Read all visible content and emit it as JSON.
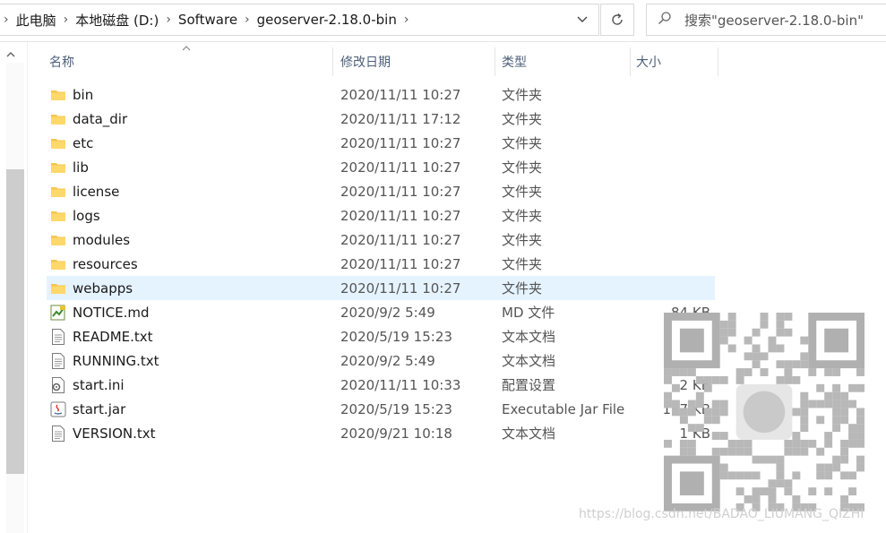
{
  "breadcrumb": {
    "items": [
      "此电脑",
      "本地磁盘 (D:)",
      "Software",
      "geoserver-2.18.0-bin"
    ]
  },
  "search": {
    "placeholder": "搜索\"geoserver-2.18.0-bin\""
  },
  "columns": {
    "name": "名称",
    "date": "修改日期",
    "type": "类型",
    "size": "大小"
  },
  "files": [
    {
      "name": "bin",
      "date": "2020/11/11 10:27",
      "type": "文件夹",
      "size": "",
      "icon": "folder-icon"
    },
    {
      "name": "data_dir",
      "date": "2020/11/11 17:12",
      "type": "文件夹",
      "size": "",
      "icon": "folder-icon"
    },
    {
      "name": "etc",
      "date": "2020/11/11 10:27",
      "type": "文件夹",
      "size": "",
      "icon": "folder-icon"
    },
    {
      "name": "lib",
      "date": "2020/11/11 10:27",
      "type": "文件夹",
      "size": "",
      "icon": "folder-icon"
    },
    {
      "name": "license",
      "date": "2020/11/11 10:27",
      "type": "文件夹",
      "size": "",
      "icon": "folder-icon"
    },
    {
      "name": "logs",
      "date": "2020/11/11 10:27",
      "type": "文件夹",
      "size": "",
      "icon": "folder-icon"
    },
    {
      "name": "modules",
      "date": "2020/11/11 10:27",
      "type": "文件夹",
      "size": "",
      "icon": "folder-icon"
    },
    {
      "name": "resources",
      "date": "2020/11/11 10:27",
      "type": "文件夹",
      "size": "",
      "icon": "folder-icon"
    },
    {
      "name": "webapps",
      "date": "2020/11/11 10:27",
      "type": "文件夹",
      "size": "",
      "icon": "folder-icon",
      "selected": true
    },
    {
      "name": "NOTICE.md",
      "date": "2020/9/2 5:49",
      "type": "MD 文件",
      "size": "84 KB",
      "icon": "markdown-file-icon"
    },
    {
      "name": "README.txt",
      "date": "2020/5/19 15:23",
      "type": "文本文档",
      "size": "1 KB",
      "icon": "text-file-icon"
    },
    {
      "name": "RUNNING.txt",
      "date": "2020/9/2 5:49",
      "type": "文本文档",
      "size": "4 KB",
      "icon": "text-file-icon"
    },
    {
      "name": "start.ini",
      "date": "2020/11/11 10:33",
      "type": "配置设置",
      "size": "2 KB",
      "icon": "config-file-icon"
    },
    {
      "name": "start.jar",
      "date": "2020/5/19 15:23",
      "type": "Executable Jar File",
      "size": "157 KB",
      "icon": "java-jar-icon"
    },
    {
      "name": "VERSION.txt",
      "date": "2020/9/21 10:18",
      "type": "文本文档",
      "size": "1 KB",
      "icon": "text-file-icon"
    }
  ],
  "watermark": "https://blog.csdn.net/BADAO_LIUMANG_QIZHI",
  "colors": {
    "selected_row": "#e5f3ff",
    "folder": "#f8c64b",
    "header_text": "#4c607a"
  }
}
